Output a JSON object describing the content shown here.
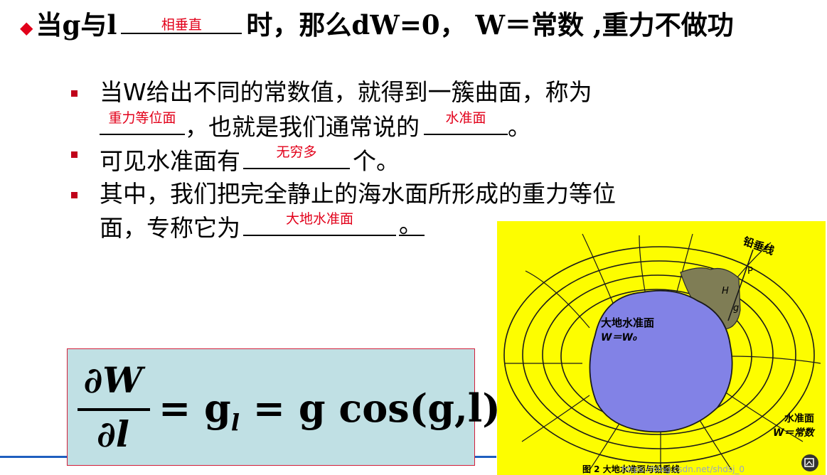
{
  "headline": {
    "lead": "当g与l",
    "blank_answer": "相垂直",
    "rest": "时，那么dW=0， W＝常数 ,重力不做功"
  },
  "bullets": [
    {
      "line1": "当W给出不同的常数值，就得到一簇曲面，称为",
      "blank1_answer": "重力等位面",
      "mid": "，也就是我们通常说的",
      "blank2_answer": "水准面",
      "end": "。"
    },
    {
      "lead": "可见水准面有",
      "blank_answer": "无穷多",
      "end": "个。"
    },
    {
      "line1": "其中，我们把完全静止的海水面所形成的重力等位",
      "line2_lead": "面，专称它为",
      "blank_answer": "大地水准面",
      "end": "。"
    }
  ],
  "formula": {
    "numerator": "∂W",
    "denominator": "∂l",
    "rhs": "= g",
    "subscript": "l",
    "rhs2": " = g cos(g,l)"
  },
  "figure": {
    "label_plumb_line": "铅垂线",
    "label_P": "P",
    "label_H": "H",
    "label_g": "g",
    "label_geoid": "大地水准面",
    "label_geoid_eq": "W＝W₀",
    "label_level": "水准面",
    "label_level_eq": "W＝常数",
    "caption": "图 2  大地水准面与铅垂线",
    "watermark": "https://blog.csdn.net/shdsj_0"
  },
  "colors": {
    "answer_red": "#e2001a",
    "bullet_red": "#c0001a",
    "formula_bg": "#c0e0e4",
    "figure_bg": "#fdfd00",
    "geoid_fill": "#8282e6"
  }
}
